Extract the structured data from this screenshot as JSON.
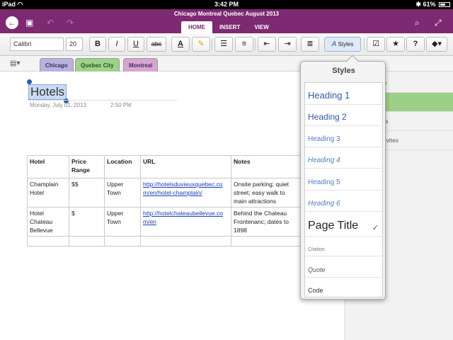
{
  "status_bar": {
    "device": "iPad",
    "wifi_icon": "wifi-icon",
    "time": "3:42 PM",
    "battery_percent": "61%",
    "battery_level": 0.61,
    "bluetooth_icon": "bluetooth-icon"
  },
  "title_bar": {
    "notebook_title": "Chicago Montreal Quebec August 2013",
    "background_color": "#7d2a73",
    "icons": [
      "back-icon",
      "share-notebook-icon",
      "undo-icon",
      "redo-icon",
      "search-icon",
      "fullscreen-icon"
    ],
    "tabs": [
      {
        "label": "HOME",
        "active": true
      },
      {
        "label": "INSERT",
        "active": false
      },
      {
        "label": "VIEW",
        "active": false
      }
    ]
  },
  "toolbar": {
    "font_name": "Calibri",
    "font_size": "20",
    "bold": "B",
    "italic": "I",
    "underline": "U",
    "strikethrough": "abc",
    "font_color": "A",
    "styles_label": "Styles",
    "icons": [
      "highlighter-icon",
      "bullet-list-icon",
      "numbered-list-icon",
      "decrease-indent-icon",
      "increase-indent-icon",
      "align-icon",
      "styles-icon",
      "checkbox-tag-icon",
      "star-tag-icon",
      "question-tag-icon",
      "more-tags-icon"
    ]
  },
  "sections": [
    {
      "label": "Chicago",
      "color": "#b8b3dd"
    },
    {
      "label": "Quebec City",
      "color": "#9fd18b",
      "active": true
    },
    {
      "label": "Montreal",
      "color": "#d7a6cf"
    }
  ],
  "page": {
    "title": "Hotels",
    "date": "Monday, July 01, 2013",
    "time": "2:50 PM",
    "table": {
      "headers": [
        "Hotel",
        "Price Range",
        "Location",
        "URL",
        "Notes"
      ],
      "rows": [
        [
          "Champlain Hotel",
          "$$",
          "Upper Town",
          "http://hotelsduvieuxquebec.com/en/hotel-champlain/",
          "Onsite parking; quiet street; easy walk to main attractions"
        ],
        [
          "Hotel Chateau Bellevue",
          "$",
          "Upper Town",
          "http://hotelchateaubellevue.com/en",
          "Behind the Chateau Frontenanc; dates to 1898"
        ],
        [
          "",
          "",
          "",
          "",
          ""
        ]
      ]
    }
  },
  "page_list": {
    "items": [
      {
        "label": "ge",
        "selected": false
      },
      {
        "label": "",
        "selected": true
      },
      {
        "label": "nts",
        "selected": false
      },
      {
        "label": "ctivites",
        "selected": false
      }
    ]
  },
  "styles_popover": {
    "title": "Styles",
    "items": [
      {
        "label": "Heading 1",
        "checked": false
      },
      {
        "label": "Heading 2",
        "checked": false
      },
      {
        "label": "Heading 3",
        "checked": false
      },
      {
        "label": "Heading 4",
        "checked": false
      },
      {
        "label": "Heading 5",
        "checked": false
      },
      {
        "label": "Heading 6",
        "checked": false
      },
      {
        "label": "Page Title",
        "checked": true
      },
      {
        "label": "Citation",
        "checked": false
      },
      {
        "label": "Quote",
        "checked": false
      },
      {
        "label": "Code",
        "checked": false
      }
    ],
    "check_mark": "✓"
  }
}
